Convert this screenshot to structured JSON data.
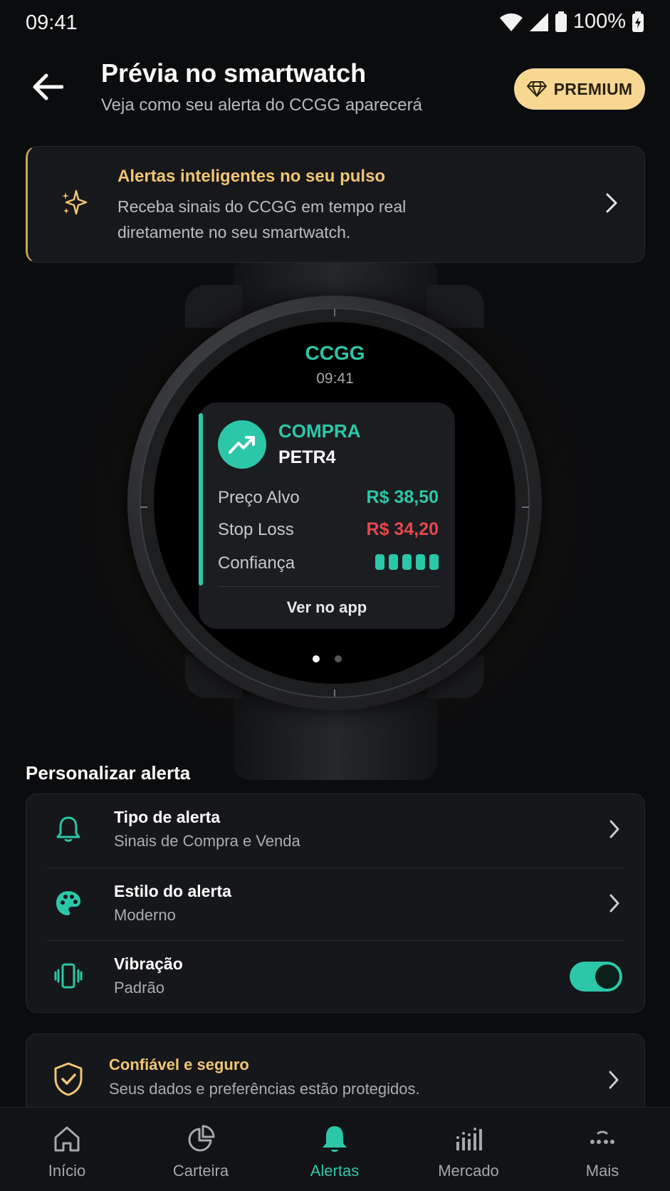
{
  "status_bar": {
    "time": "09:41",
    "battery": "100%"
  },
  "header": {
    "title": "Prévia no smartwatch",
    "subtitle": "Veja como seu alerta do CCGG aparecerá",
    "premium_label": "PREMIUM"
  },
  "promo": {
    "title": "Alertas inteligentes no seu pulso",
    "text": "Receba sinais do CCGG em tempo real diretamente no seu smartwatch."
  },
  "watch": {
    "app_name": "CCGG",
    "time": "09:41",
    "action": "COMPRA",
    "ticker": "PETR4",
    "target_label": "Preço Alvo",
    "target_value": "R$ 38,50",
    "stop_label": "Stop Loss",
    "stop_value": "R$ 34,20",
    "confidence_label": "Confiança",
    "confidence_level": 5,
    "confidence_max": 5,
    "link_label": "Ver no app",
    "page_indicator": {
      "current": 1,
      "total": 2
    }
  },
  "customize": {
    "section_title": "Personalizar alerta",
    "rows": [
      {
        "title": "Tipo de alerta",
        "subtitle": "Sinais de Compra e Venda",
        "icon": "bell-icon"
      },
      {
        "title": "Estilo do alerta",
        "subtitle": "Moderno",
        "icon": "palette-icon"
      },
      {
        "title": "Vibração",
        "subtitle": "Padrão",
        "icon": "vibration-icon",
        "toggle_on": true
      }
    ]
  },
  "trust": {
    "title": "Confiável e seguro",
    "text": "Seus dados e preferências estão protegidos."
  },
  "nav": {
    "items": [
      {
        "label": "Início",
        "icon": "home-icon"
      },
      {
        "label": "Carteira",
        "icon": "pie-chart-icon"
      },
      {
        "label": "Alertas",
        "icon": "bell-icon",
        "active": true
      },
      {
        "label": "Mercado",
        "icon": "bar-chart-icon"
      },
      {
        "label": "Mais",
        "icon": "more-icon"
      }
    ]
  },
  "colors": {
    "accent": "#2cc7a8",
    "gold": "#f0c573",
    "premium_bg": "#f7d792",
    "danger": "#e5484d",
    "background": "#0b0c0e"
  }
}
